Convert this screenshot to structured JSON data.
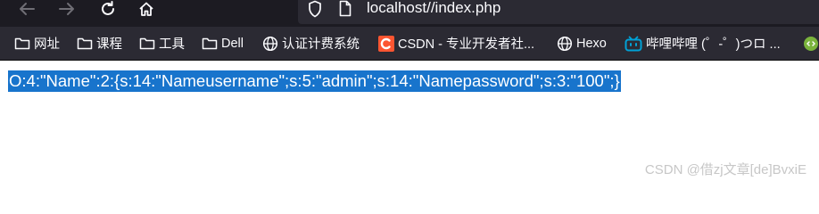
{
  "browser": {
    "url": "localhost//index.php",
    "icons": {
      "back": "arrow-left-icon",
      "forward": "arrow-right-icon",
      "reload": "reload-icon",
      "home": "home-icon",
      "site_info": "shield-icon",
      "page": "page-icon"
    }
  },
  "bookmarks": [
    {
      "label": "网址",
      "icon": "folder-icon"
    },
    {
      "label": "课程",
      "icon": "folder-icon"
    },
    {
      "label": "工具",
      "icon": "folder-icon"
    },
    {
      "label": "Dell",
      "icon": "folder-icon"
    },
    {
      "label": "认证计费系统",
      "icon": "globe-icon"
    },
    {
      "label": "CSDN - 专业开发者社...",
      "icon": "csdn-icon"
    },
    {
      "label": "Hexo",
      "icon": "globe-icon"
    },
    {
      "label": "哔哩哔哩 (゜-゜)つロ ...",
      "icon": "bilibili-icon"
    }
  ],
  "page": {
    "serialized_output": "O:4:\"Name\":2:{s:14:\"Nameusername\";s:5:\"admin\";s:14:\"Namepassword\";s:3:\"100\";}",
    "selection_color": "#1874cc"
  },
  "watermark": "CSDN @借zj文章[de]BvxiE"
}
